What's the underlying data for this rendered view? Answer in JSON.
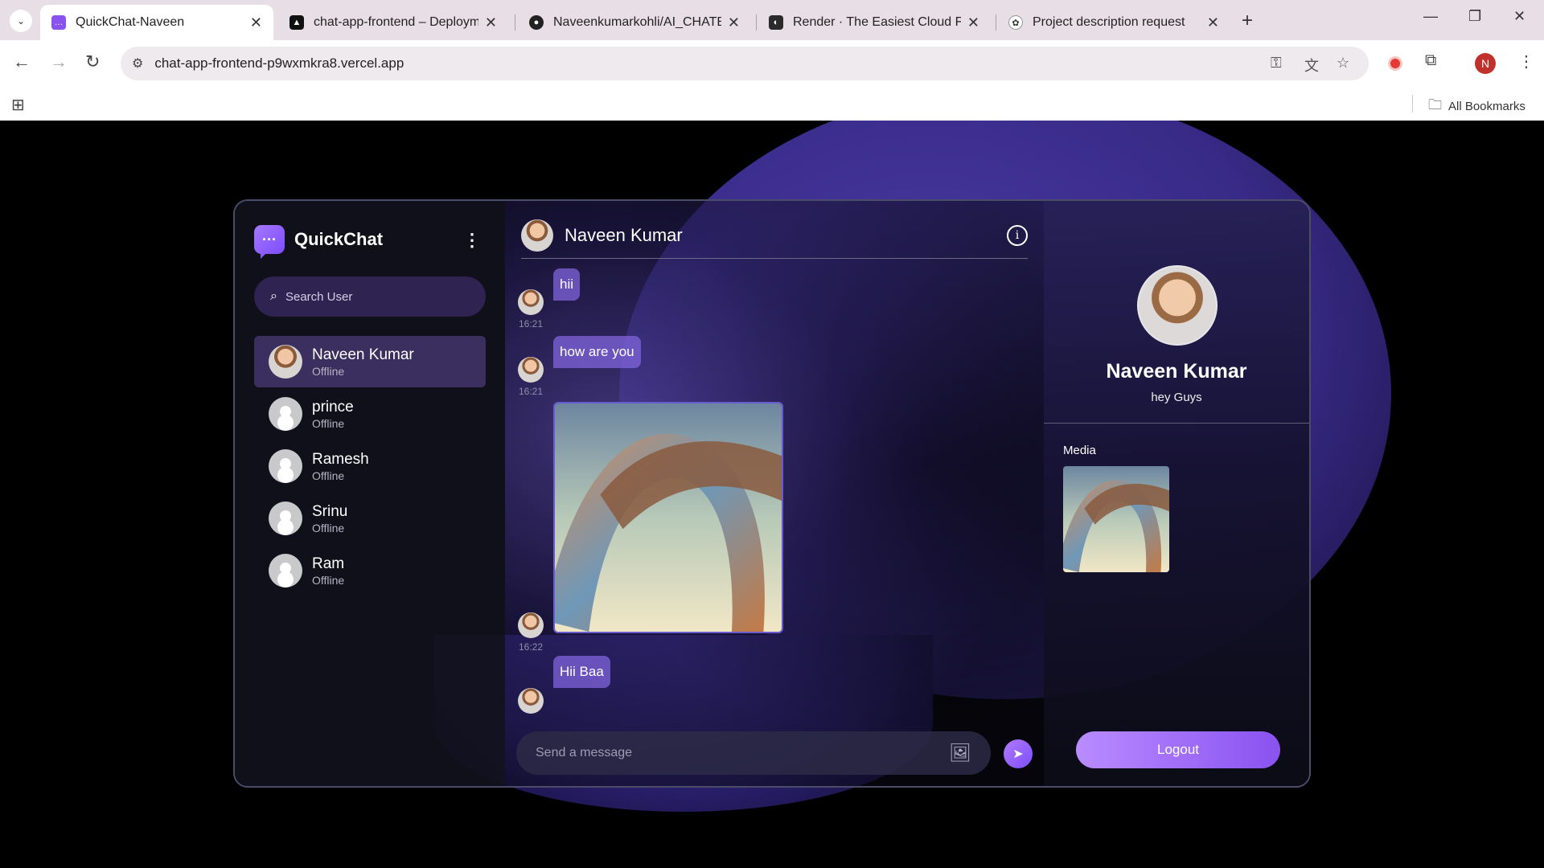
{
  "browser": {
    "tabs": [
      {
        "title": "QuickChat-Naveen",
        "active": true,
        "icon": "quickchat-favicon"
      },
      {
        "title": "chat-app-frontend – Deployme",
        "active": false,
        "icon": "vercel-favicon"
      },
      {
        "title": "Naveenkumarkohli/AI_CHATBO",
        "active": false,
        "icon": "github-favicon"
      },
      {
        "title": "Render · The Easiest Cloud For /",
        "active": false,
        "icon": "render-favicon"
      },
      {
        "title": "Project description request",
        "active": false,
        "icon": "chatgpt-favicon"
      }
    ],
    "url": "chat-app-frontend-p9wxmkra8.vercel.app",
    "profile_initial": "N",
    "all_bookmarks": "All Bookmarks"
  },
  "app": {
    "brand": "QuickChat",
    "search_placeholder": "Search User",
    "users": [
      {
        "name": "Naveen Kumar",
        "status": "Offline",
        "selected": true,
        "photo": true
      },
      {
        "name": "prince",
        "status": "Offline",
        "selected": false,
        "photo": false
      },
      {
        "name": "Ramesh",
        "status": "Offline",
        "selected": false,
        "photo": false
      },
      {
        "name": "Srinu",
        "status": "Offline",
        "selected": false,
        "photo": false
      },
      {
        "name": "Ram",
        "status": "Offline",
        "selected": false,
        "photo": false
      }
    ],
    "chat": {
      "contact_name": "Naveen Kumar",
      "messages": [
        {
          "type": "text",
          "text": "hii",
          "time": "16:21"
        },
        {
          "type": "text",
          "text": "how are you",
          "time": "16:21"
        },
        {
          "type": "image",
          "time": "16:22"
        },
        {
          "type": "text",
          "text": "Hii Baa",
          "time": ""
        }
      ],
      "composer_placeholder": "Send a message"
    },
    "profile": {
      "name": "Naveen Kumar",
      "bio": "hey Guys",
      "media_label": "Media",
      "logout_label": "Logout"
    },
    "colors": {
      "accent": "#8a52f0",
      "bubble": "#8064dc",
      "selected_row": "#3a2f5e"
    }
  }
}
